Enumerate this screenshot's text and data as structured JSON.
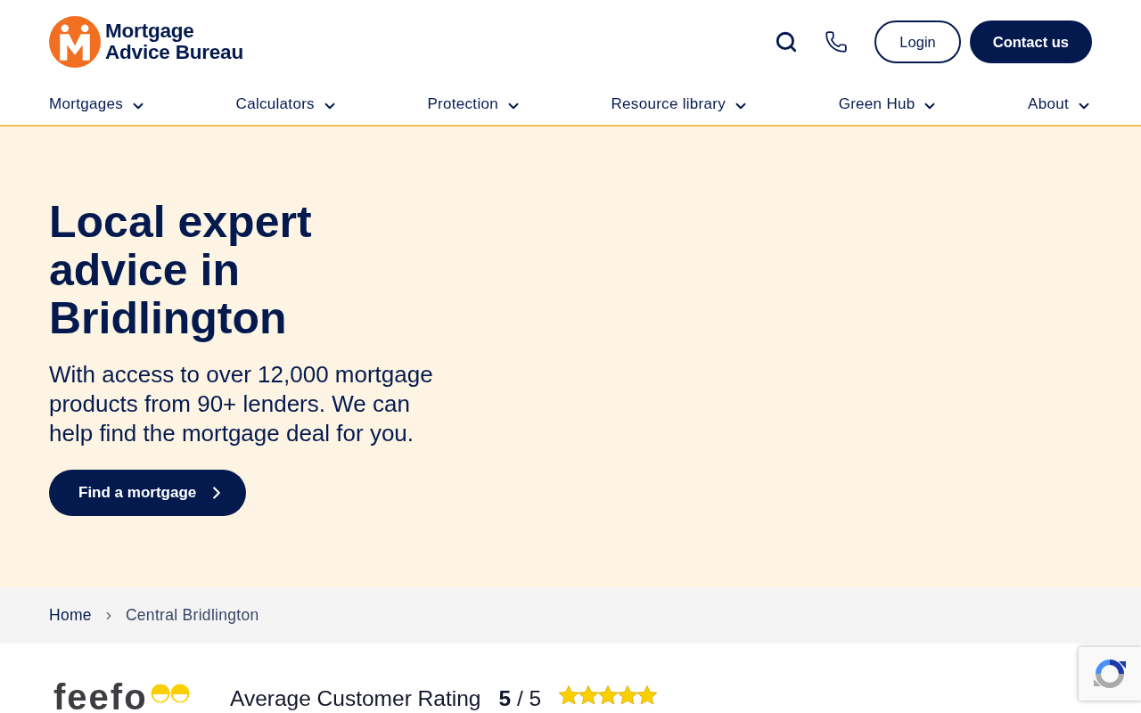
{
  "header": {
    "logo": {
      "lines": [
        "Mortgage",
        "Advice Bureau"
      ]
    },
    "buttons": [
      {
        "label": "Login",
        "kind": "outline"
      },
      {
        "label": "Contact us",
        "kind": "filled"
      }
    ]
  },
  "nav": [
    {
      "label": "Mortgages"
    },
    {
      "label": "Calculators"
    },
    {
      "label": "Protection"
    },
    {
      "label": "Resource library"
    },
    {
      "label": "Green Hub"
    },
    {
      "label": "About"
    }
  ],
  "hero": {
    "title": "Local expert advice in Bridlington",
    "text": "With access to over 12,000 mortgage products from 90+ lenders. We can help find the mortgage deal for you.",
    "button": "Find a mortgage"
  },
  "breadcrumb": [
    {
      "label": "Home",
      "current": false
    },
    {
      "label": "Central Bridlington",
      "current": true
    }
  ],
  "rating": {
    "logo": "feefo",
    "label": "Average Customer Rating",
    "score": "**5** / 5",
    "stars": 5
  }
}
